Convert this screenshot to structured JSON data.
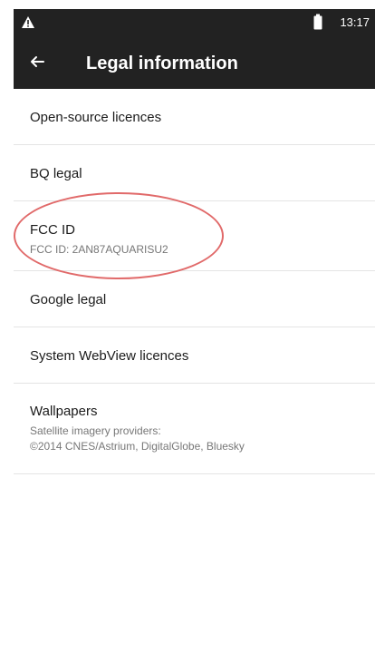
{
  "status_bar": {
    "time": "13:17",
    "left_icon": "warning-icon",
    "battery_icon": "battery-icon"
  },
  "toolbar": {
    "back_icon": "back-arrow-icon",
    "title": "Legal information"
  },
  "colors": {
    "status_bar_bg": "#222222",
    "toolbar_bg": "#222222",
    "text_primary": "#1b1b1b",
    "text_secondary": "#777777",
    "divider": "#e4e4e4",
    "highlight": "#e16a6a"
  },
  "items": [
    {
      "title": "Open-source licences"
    },
    {
      "title": "BQ legal"
    },
    {
      "title": "FCC ID",
      "summary": "FCC ID: 2AN87AQUARISU2"
    },
    {
      "title": "Google legal"
    },
    {
      "title": "System WebView licences"
    },
    {
      "title": "Wallpapers",
      "summary_line1": "Satellite imagery providers:",
      "summary_line2": "©2014 CNES/Astrium, DigitalGlobe, Bluesky"
    }
  ]
}
